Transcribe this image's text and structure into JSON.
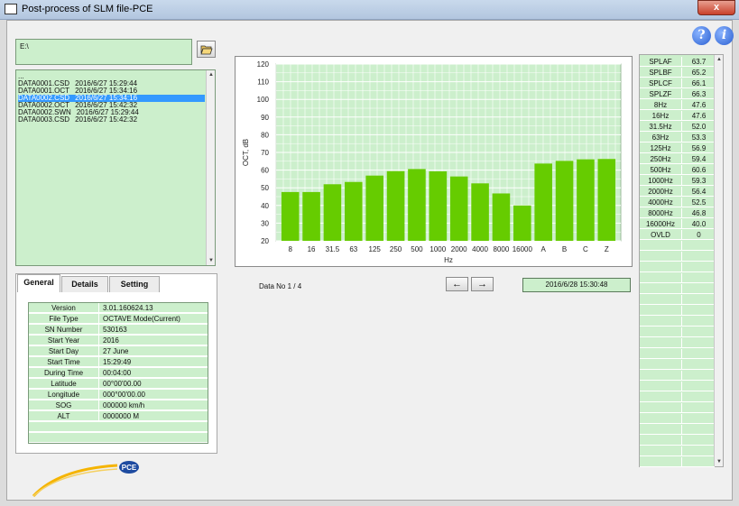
{
  "window": {
    "title": "Post-process of SLM file-PCE",
    "close_label": "x"
  },
  "toolbar": {
    "help_label": "?",
    "info_label": "i"
  },
  "path": {
    "value": "E:\\"
  },
  "file_list": {
    "items": [
      {
        "name": "...",
        "date": ""
      },
      {
        "name": "DATA0001.CSD",
        "date": "2016/6/27 15:29:44"
      },
      {
        "name": "DATA0001.OCT",
        "date": "2016/6/27 15:34:16"
      },
      {
        "name": "DATA0002.CSD",
        "date": "2016/6/27 15:34:16",
        "selected": true
      },
      {
        "name": "DATA0002.OCT",
        "date": "2016/6/27 15:42:32"
      },
      {
        "name": "DATA0002.SWN",
        "date": "2016/6/27 15:29:44"
      },
      {
        "name": "DATA0003.CSD",
        "date": "2016/6/27 15:42:32"
      }
    ]
  },
  "tabs": [
    {
      "label": "General",
      "active": true
    },
    {
      "label": "Details",
      "active": false
    },
    {
      "label": "Setting",
      "active": false
    }
  ],
  "general_info": [
    {
      "key": "Version",
      "value": "3.01.160624.13"
    },
    {
      "key": "File Type",
      "value": "OCTAVE Mode(Current)"
    },
    {
      "key": "SN Number",
      "value": "530163"
    },
    {
      "key": "Start Year",
      "value": "2016"
    },
    {
      "key": "Start Day",
      "value": "27 June"
    },
    {
      "key": "Start Time",
      "value": "15:29:49"
    },
    {
      "key": "During Time",
      "value": "00:04:00"
    },
    {
      "key": "Latitude",
      "value": "00°00'00.00"
    },
    {
      "key": "Longitude",
      "value": "000°00'00.00"
    },
    {
      "key": "SOG",
      "value": "000000 km/h"
    },
    {
      "key": "ALT",
      "value": "0000000 M"
    }
  ],
  "logo_text": "PCE",
  "data_no": {
    "label": "Data No",
    "current": "1",
    "total": "4"
  },
  "nav": {
    "prev": "←",
    "next": "→"
  },
  "datetime": "2016/6/28 15:30:48",
  "values_table": [
    {
      "key": "SPLAF",
      "value": "63.7"
    },
    {
      "key": "SPLBF",
      "value": "65.2"
    },
    {
      "key": "SPLCF",
      "value": "66.1"
    },
    {
      "key": "SPLZF",
      "value": "66.3"
    },
    {
      "key": "8Hz",
      "value": "47.6"
    },
    {
      "key": "16Hz",
      "value": "47.6"
    },
    {
      "key": "31.5Hz",
      "value": "52.0"
    },
    {
      "key": "63Hz",
      "value": "53.3"
    },
    {
      "key": "125Hz",
      "value": "56.9"
    },
    {
      "key": "250Hz",
      "value": "59.4"
    },
    {
      "key": "500Hz",
      "value": "60.6"
    },
    {
      "key": "1000Hz",
      "value": "59.3"
    },
    {
      "key": "2000Hz",
      "value": "56.4"
    },
    {
      "key": "4000Hz",
      "value": "52.5"
    },
    {
      "key": "8000Hz",
      "value": "46.8"
    },
    {
      "key": "16000Hz",
      "value": "40.0"
    },
    {
      "key": "OVLD",
      "value": "0"
    }
  ],
  "colors": {
    "bar": "#66cc00",
    "plot_bg": "#ccefcc",
    "grid": "#ffffff",
    "selection": "#3399ff"
  },
  "chart_data": {
    "type": "bar",
    "categories": [
      "8",
      "16",
      "31.5",
      "63",
      "125",
      "250",
      "500",
      "1000",
      "2000",
      "4000",
      "8000",
      "16000",
      "A",
      "B",
      "C",
      "Z"
    ],
    "values": [
      47.6,
      47.6,
      52.0,
      53.3,
      56.9,
      59.4,
      60.6,
      59.3,
      56.4,
      52.5,
      46.8,
      40.0,
      63.7,
      65.2,
      66.1,
      66.3
    ],
    "ylabel": "OCT, dB",
    "xlabel": "Hz",
    "ylim": [
      20,
      120
    ],
    "yticks": [
      20,
      30,
      40,
      50,
      60,
      70,
      80,
      90,
      100,
      110,
      120
    ],
    "grid": true
  }
}
